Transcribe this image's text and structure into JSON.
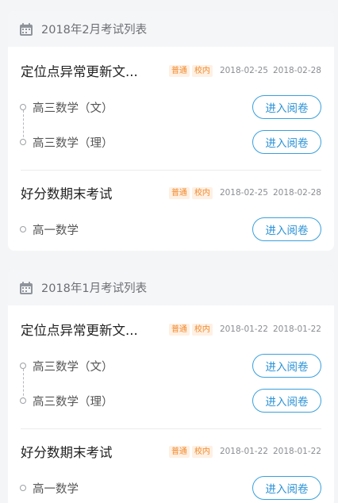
{
  "months": [
    {
      "title": "2018年2月考试列表",
      "exams": [
        {
          "name": "定位点异常更新文...",
          "badges": [
            "普通",
            "校内"
          ],
          "start": "2018-02-25",
          "end": "2018-02-28",
          "subjects": [
            {
              "name": "高三数学（文）",
              "button": "进入阅卷"
            },
            {
              "name": "高三数学（理）",
              "button": "进入阅卷"
            }
          ]
        },
        {
          "name": "好分数期末考试",
          "badges": [
            "普通",
            "校内"
          ],
          "start": "2018-02-25",
          "end": "2018-02-28",
          "subjects": [
            {
              "name": "高一数学",
              "button": "进入阅卷"
            }
          ]
        }
      ]
    },
    {
      "title": "2018年1月考试列表",
      "exams": [
        {
          "name": "定位点异常更新文...",
          "badges": [
            "普通",
            "校内"
          ],
          "start": "2018-01-22",
          "end": "2018-01-22",
          "subjects": [
            {
              "name": "高三数学（文）",
              "button": "进入阅卷"
            },
            {
              "name": "高三数学（理）",
              "button": "进入阅卷"
            }
          ]
        },
        {
          "name": "好分数期末考试",
          "badges": [
            "普通",
            "校内"
          ],
          "start": "2018-01-22",
          "end": "2018-01-22",
          "subjects": [
            {
              "name": "高一数学",
              "button": "进入阅卷"
            }
          ]
        }
      ]
    }
  ],
  "icons": {
    "month_header": "calendar-icon"
  },
  "colors": {
    "accent": "#2b92d6",
    "badge_text": "#f08a2c",
    "badge_bg": "#fff0e3"
  }
}
